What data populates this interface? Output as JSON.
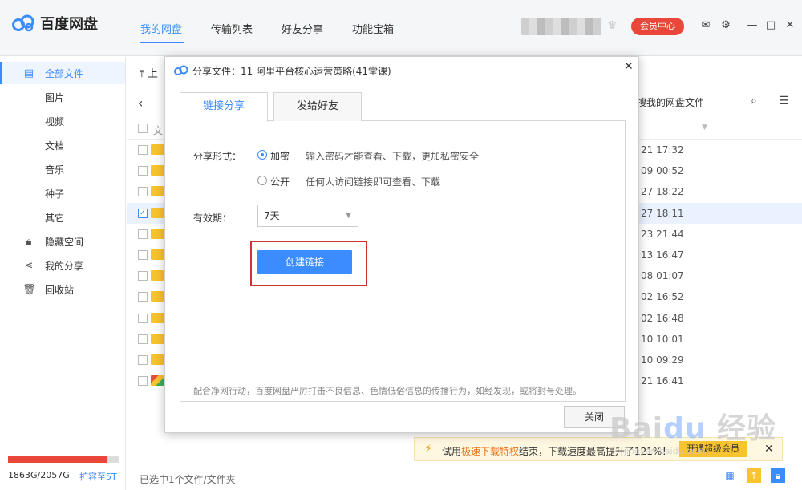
{
  "app": {
    "name": "百度网盘",
    "colors": {
      "accent": "#3b8cff",
      "vip": "#e8473a",
      "folder": "#f7c32e",
      "highlight": "#cc3333"
    }
  },
  "header": {
    "nav": [
      "我的网盘",
      "传输列表",
      "好友分享",
      "功能宝箱"
    ],
    "vip_label": "会员中心",
    "icons": [
      "mail-icon",
      "gear-icon",
      "minimize-icon",
      "maximize-icon",
      "close-icon"
    ]
  },
  "sidebar": {
    "items": [
      {
        "label": "全部文件",
        "icon": "file-icon"
      },
      {
        "label": "图片"
      },
      {
        "label": "视频"
      },
      {
        "label": "文档"
      },
      {
        "label": "音乐"
      },
      {
        "label": "种子"
      },
      {
        "label": "其它"
      },
      {
        "label": "隐藏空间",
        "icon": "lock-icon"
      },
      {
        "label": "我的分享",
        "icon": "share-icon"
      },
      {
        "label": "回收站",
        "icon": "trash-icon"
      }
    ],
    "storage": {
      "text": "1863G/2057G",
      "fraction": 0.906,
      "expand_label": "扩容至5T"
    }
  },
  "main": {
    "upload_label": "上",
    "search_hint": "搜我的网盘文件",
    "header_col": "文",
    "rows": [
      {
        "date": "21 17:32",
        "selected": false
      },
      {
        "date": "09 00:52",
        "selected": false
      },
      {
        "date": "27 18:22",
        "selected": false
      },
      {
        "date": "27 18:11",
        "selected": true
      },
      {
        "date": "23 21:44",
        "selected": false
      },
      {
        "date": "13 16:47",
        "selected": false
      },
      {
        "date": "08 01:07",
        "selected": false
      },
      {
        "date": "02 16:52",
        "selected": false
      },
      {
        "date": "02 16:48",
        "selected": false
      },
      {
        "date": "10 10:01",
        "selected": false
      },
      {
        "date": "10 09:29",
        "selected": false
      },
      {
        "date": "21 16:41",
        "selected": false
      }
    ],
    "status": "已选中1个文件/文件夹"
  },
  "notification": {
    "text_prefix": "试用",
    "text_highlight": "极速下载特权",
    "text_suffix": "结束，下载速度最高提升了121%！",
    "button": "开通超级会员"
  },
  "modal": {
    "title": "分享文件：11 阿里平台核心运营策略(41堂课)",
    "tabs": [
      "链接分享",
      "发给好友"
    ],
    "share_form_label": "分享形式：",
    "options": [
      {
        "label": "加密",
        "desc": "输入密码才能查看、下载，更加私密安全",
        "checked": true
      },
      {
        "label": "公开",
        "desc": "任何人访问链接即可查看、下载",
        "checked": false
      }
    ],
    "validity_label": "有效期：",
    "validity_value": "7天",
    "create_button": "创建链接",
    "notice": "配合净网行动，百度网盘严厉打击不良信息、色情低俗信息的传播行为，如经发现，或将封号处理。",
    "close_button": "关闭"
  },
  "watermark": {
    "text": "Baidu 经验",
    "sub": "jingyan.baidu.com"
  }
}
